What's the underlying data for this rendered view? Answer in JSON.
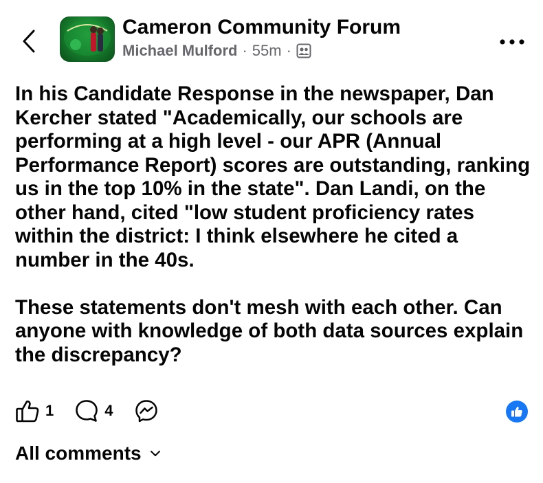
{
  "header": {
    "group_name": "Cameron Community Forum",
    "author": "Michael Mulford",
    "separator": "·",
    "time": "55m",
    "privacy_icon": "group-members-icon",
    "back_icon": "chevron-left-icon",
    "more_icon": "more-horizontal-icon"
  },
  "post": {
    "paragraphs": [
      "In his Candidate Response in the newspaper, Dan Kercher stated \"Academically, our schools are performing at a high level - our APR (Annual Performance Report) scores are outstanding, ranking us in the top 10% in the state\".  Dan Landi, on the other hand, cited \"low student proficiency rates within the district:  I think elsewhere he cited a number in the 40s.",
      "These statements don't mesh with each other. Can anyone with knowledge of both data sources explain the discrepancy?"
    ]
  },
  "actions": {
    "like_count": "1",
    "comment_count": "4",
    "like_icon": "thumbs-up-icon",
    "comment_icon": "comment-bubble-icon",
    "share_icon": "messenger-icon",
    "reaction_icon": "like-reaction-icon",
    "reaction_color": "#1877f2"
  },
  "comments": {
    "label": "All comments",
    "dropdown_icon": "chevron-down-icon"
  }
}
